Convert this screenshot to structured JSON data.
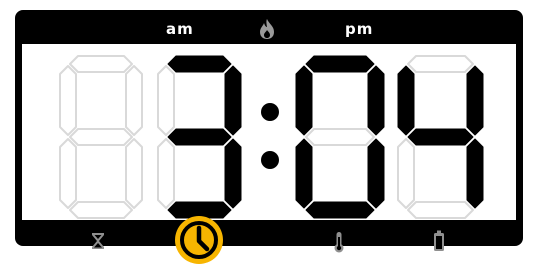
{
  "top_bar": {
    "am_label": "am",
    "pm_label": "pm",
    "flame_icon": "flame-icon",
    "am_active": false,
    "pm_active": false
  },
  "clock": {
    "time": "3:04",
    "digits": [
      "",
      "3",
      "0",
      "4"
    ],
    "colon_visible": true
  },
  "bottom_bar": {
    "icons": [
      "hourglass-icon",
      "clock-icon",
      "thermometer-icon",
      "battery-icon"
    ],
    "active_icon": "clock-icon"
  },
  "colors": {
    "frame": "#000000",
    "display_background": "#ffffff",
    "segment_on": "#000000",
    "segment_off_fill": "#ffffff",
    "segment_off_stroke": "#d9d9d9",
    "bar_text": "#ffffff",
    "bar_icon_dim": "#9a9a9a",
    "accent": "#f7b500"
  }
}
